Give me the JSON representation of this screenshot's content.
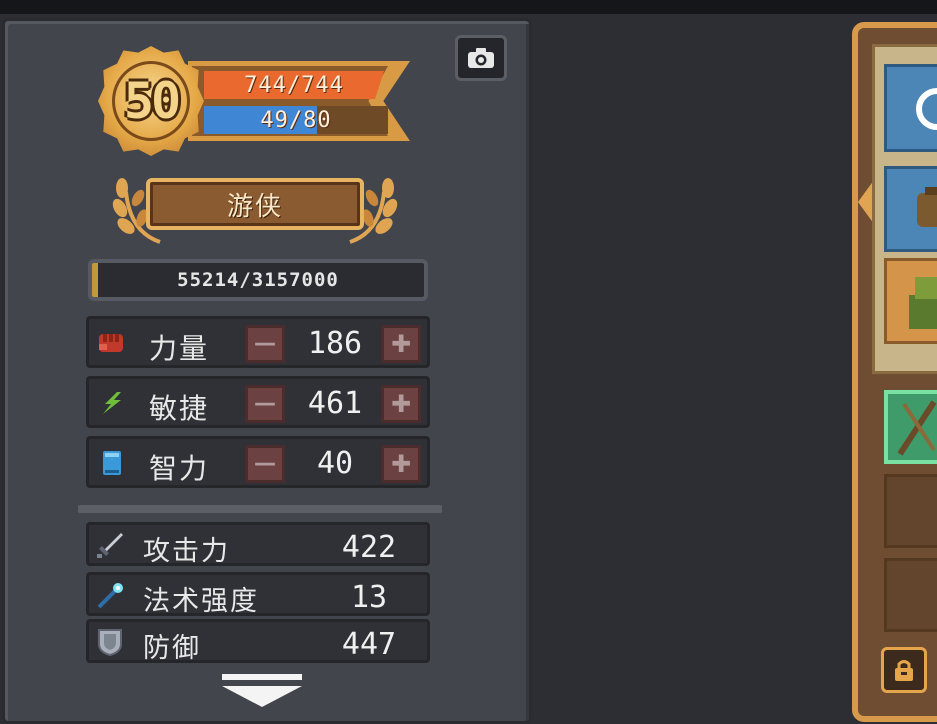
{
  "character": {
    "level": "50",
    "hp": "744/744",
    "mp": "49/80",
    "mp_fraction": 0.6125,
    "class_name": "游侠",
    "exp": "55214/3157000",
    "exp_fraction": 0.0175
  },
  "attributes": [
    {
      "label": "力量",
      "value": "186",
      "icon": "fist-icon"
    },
    {
      "label": "敏捷",
      "value": "461",
      "icon": "lightning-icon"
    },
    {
      "label": "智力",
      "value": "40",
      "icon": "book-icon"
    }
  ],
  "stats": [
    {
      "label": "攻击力",
      "value": "422",
      "icon": "sword-icon"
    },
    {
      "label": "法术强度",
      "value": "13",
      "icon": "magic-wand-icon"
    },
    {
      "label": "防御",
      "value": "447",
      "icon": "shield-icon"
    }
  ],
  "controls": {
    "minus_symbol": "—",
    "plus_symbol": "✚"
  },
  "colors": {
    "hp": "#e9692e",
    "mp": "#3f86d4",
    "exp": "#c09a36",
    "gold": "#e7b561"
  }
}
